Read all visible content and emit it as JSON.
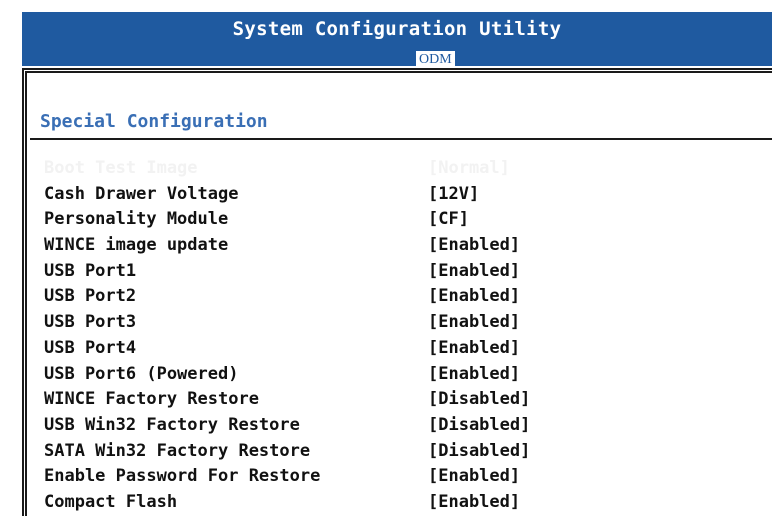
{
  "window": {
    "title": "System Configuration Utility",
    "active_tab": "ODM"
  },
  "section": {
    "title": "Special Configuration"
  },
  "settings": [
    {
      "label": "Boot Test Image",
      "value": "[Normal]",
      "selected": true
    },
    {
      "label": "Cash Drawer Voltage",
      "value": "[12V]"
    },
    {
      "label": "Personality Module",
      "value": "[CF]"
    },
    {
      "label": "WINCE image update",
      "value": "[Enabled]"
    },
    {
      "label": "USB Port1",
      "value": "[Enabled]"
    },
    {
      "label": "USB Port2",
      "value": "[Enabled]"
    },
    {
      "label": "USB Port3",
      "value": "[Enabled]"
    },
    {
      "label": "USB Port4",
      "value": "[Enabled]"
    },
    {
      "label": "USB Port6 (Powered)",
      "value": "[Enabled]"
    },
    {
      "label": "WINCE Factory Restore",
      "value": "[Disabled]"
    },
    {
      "label": "USB Win32 Factory Restore",
      "value": "[Disabled]"
    },
    {
      "label": "SATA Win32 Factory Restore",
      "value": "[Disabled]"
    },
    {
      "label": "Enable Password For Restore",
      "value": "[Enabled]"
    },
    {
      "label": "Compact Flash",
      "value": "[Enabled]"
    }
  ],
  "colors": {
    "titlebar": "#1f5aa0",
    "section_title": "#3a6fb5",
    "text": "#111111",
    "selected_text": "#f2f2f2"
  }
}
